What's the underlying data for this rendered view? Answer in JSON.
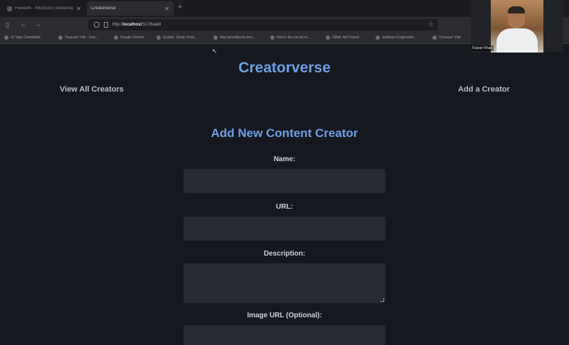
{
  "browser": {
    "tabs": [
      {
        "title": "Firework - WEB103 | Advanced"
      },
      {
        "title": "Creatorverse"
      }
    ],
    "new_tab_glyph": "+",
    "url_prefix": "http://",
    "url_host": "localhost",
    "url_rest": ":5176/add",
    "bookmarks": [
      "UI Vagr Chartfields",
      "Treasure Vidi - Goo...",
      "Google Gemini",
      "Quizlet: Study Tools...",
      "http://pixellbama.kno...",
      "Here's the secret m...",
      "Gitlab Not Found",
      "Software Engineerin...",
      "Treasure Vide"
    ]
  },
  "webcam": {
    "name_label": "Faizan Khan"
  },
  "site": {
    "title": "Creatorverse",
    "nav_view_all": "View All Creators",
    "nav_add": "Add a Creator"
  },
  "form": {
    "heading": "Add New Content Creator",
    "name_label": "Name:",
    "url_label": "URL:",
    "description_label": "Description:",
    "image_label": "Image URL (Optional):",
    "name_value": "",
    "url_value": "",
    "description_value": "",
    "image_value": ""
  }
}
